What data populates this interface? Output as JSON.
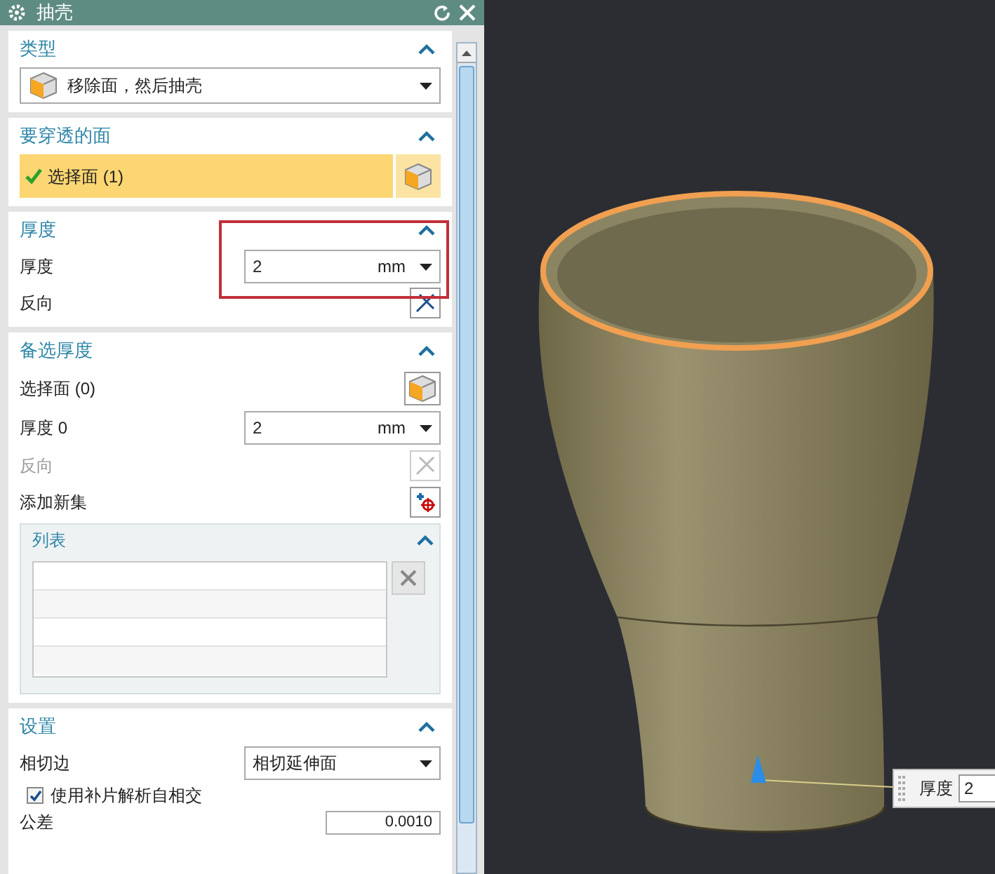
{
  "window": {
    "title": "抽壳"
  },
  "type_section": {
    "title": "类型",
    "expanded": true,
    "dropdown_value": "移除面，然后抽壳"
  },
  "faces_section": {
    "title": "要穿透的面",
    "expanded": true,
    "select_label": "选择面 (1)",
    "complete": true
  },
  "thickness_section": {
    "title": "厚度",
    "expanded": true,
    "thickness_label": "厚度",
    "value": "2",
    "unit": "mm",
    "reverse_label": "反向",
    "annotated": true
  },
  "alternate_section": {
    "title": "备选厚度",
    "expanded": true,
    "select_label": "选择面 (0)",
    "thickness_label": "厚度 0",
    "value": "2",
    "unit": "mm",
    "reverse_label": "反向",
    "reverse_disabled": true,
    "add_set_label": "添加新集",
    "list": {
      "title": "列表",
      "expanded": true
    }
  },
  "settings_section": {
    "title": "设置",
    "expanded": true,
    "tangent_label": "相切边",
    "tangent_value": "相切延伸面",
    "checkbox": {
      "label": "使用补片解析自相交",
      "checked": true
    },
    "tolerance_label": "公差",
    "tolerance_value": "0.0010"
  },
  "viewport": {
    "thickness_label": "厚度",
    "thickness_value": "2"
  }
}
